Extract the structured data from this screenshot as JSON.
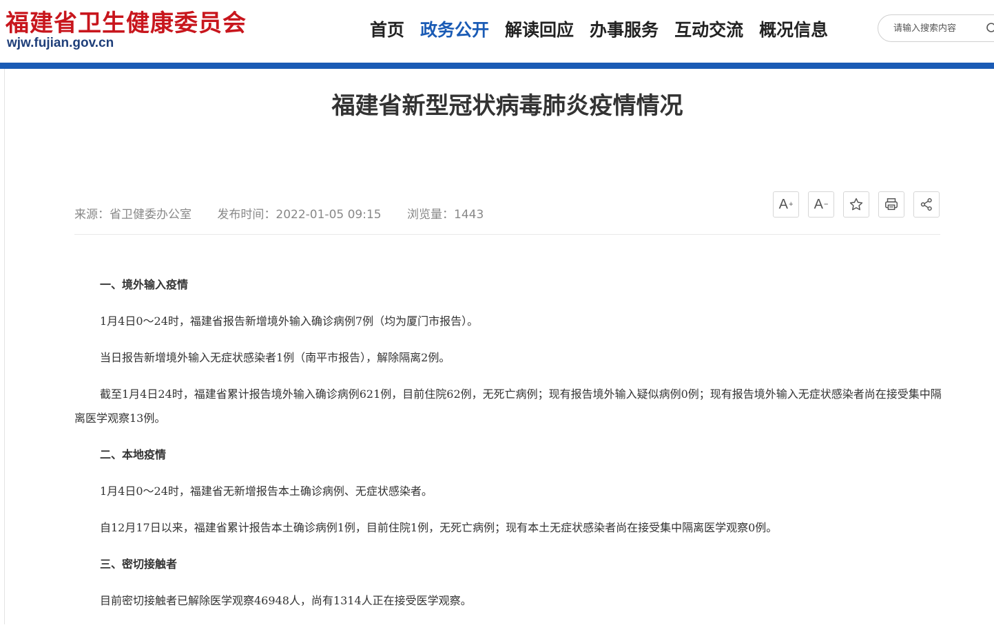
{
  "header": {
    "logo_title": "福建省卫生健康委员会",
    "logo_domain": "wjw.fujian.gov.cn",
    "nav": [
      {
        "label": "首页",
        "active": false
      },
      {
        "label": "政务公开",
        "active": true
      },
      {
        "label": "解读回应",
        "active": false
      },
      {
        "label": "办事服务",
        "active": false
      },
      {
        "label": "互动交流",
        "active": false
      },
      {
        "label": "概况信息",
        "active": false
      }
    ],
    "search_placeholder": "请输入搜索内容"
  },
  "article": {
    "title": "福建省新型冠状病毒肺炎疫情情况",
    "meta": {
      "source": "来源：省卫健委办公室",
      "publish_time": "发布时间：2022-01-05 09:15",
      "views": "浏览量：1443"
    },
    "tools": {
      "font_increase": "A",
      "font_increase_sup": "+",
      "font_decrease": "A",
      "font_decrease_sup": "−"
    },
    "paragraphs": [
      {
        "text": "一、境外输入疫情",
        "heading": true
      },
      {
        "text": "1月4日0～24时，福建省报告新增境外输入确诊病例7例（均为厦门市报告）。",
        "heading": false
      },
      {
        "text": "当日报告新增境外输入无症状感染者1例（南平市报告），解除隔离2例。",
        "heading": false
      },
      {
        "text": "截至1月4日24时，福建省累计报告境外输入确诊病例621例，目前住院62例，无死亡病例；现有报告境外输入疑似病例0例；现有报告境外输入无症状感染者尚在接受集中隔离医学观察13例。",
        "heading": false
      },
      {
        "text": "二、本地疫情",
        "heading": true
      },
      {
        "text": "1月4日0～24时，福建省无新增报告本土确诊病例、无症状感染者。",
        "heading": false
      },
      {
        "text": "自12月17日以来，福建省累计报告本土确诊病例1例，目前住院1例，无死亡病例；现有本土无症状感染者尚在接受集中隔离医学观察0例。",
        "heading": false
      },
      {
        "text": "三、密切接触者",
        "heading": true
      },
      {
        "text": "目前密切接触者已解除医学观察46948人，尚有1314人正在接受医学观察。",
        "heading": false
      }
    ]
  },
  "colors": {
    "brand_red": "#c8161d",
    "brand_blue": "#1a5bb5",
    "nav_active": "#1a5bb5"
  }
}
